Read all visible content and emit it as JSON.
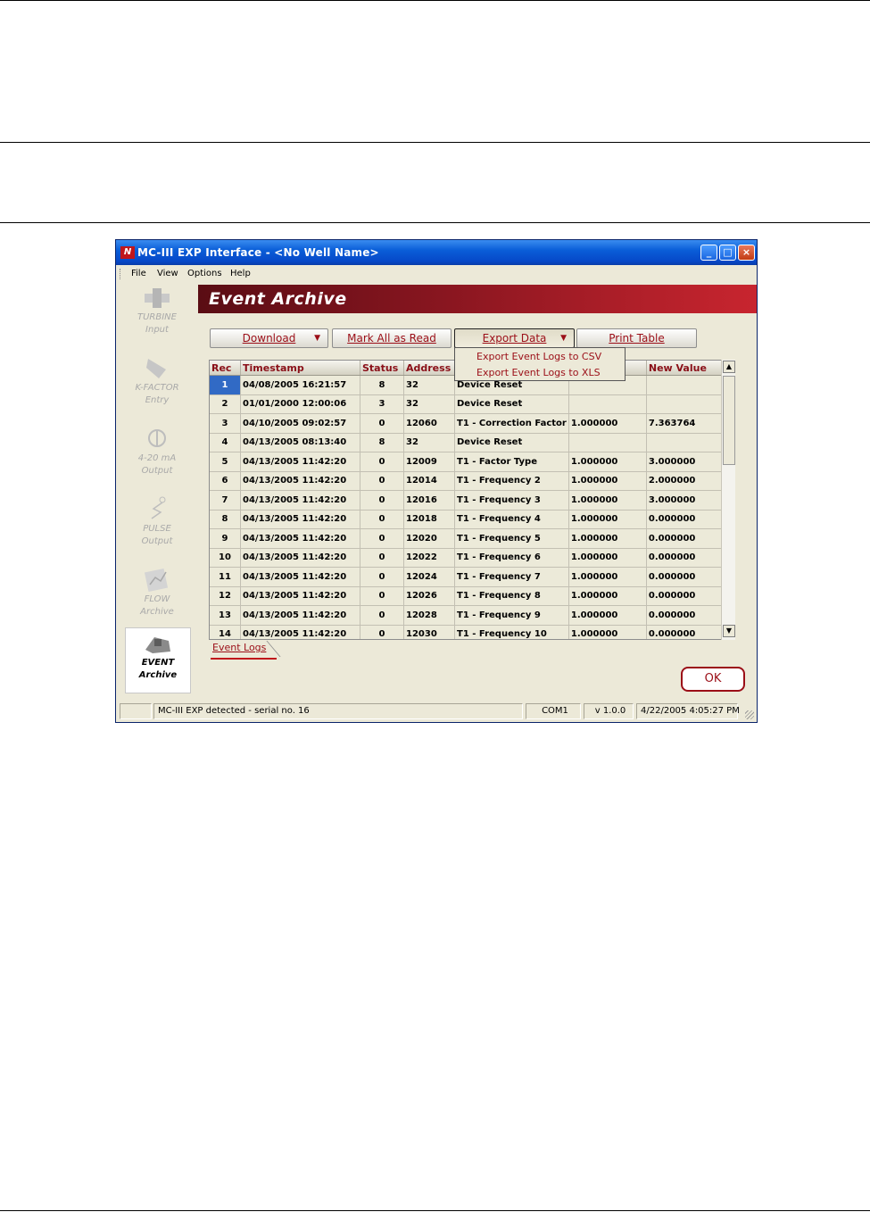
{
  "window": {
    "title": "MC-III EXP Interface - <No Well Name>",
    "logo_text": "N",
    "buttons": {
      "minimize": "_",
      "maximize": "□",
      "close": "×"
    }
  },
  "menu": [
    "File",
    "View",
    "Options",
    "Help"
  ],
  "sidebar": [
    {
      "line1": "TURBINE",
      "line2": "Input",
      "icon": "turbine-icon"
    },
    {
      "line1": "K-FACTOR",
      "line2": "Entry",
      "icon": "k-factor-icon"
    },
    {
      "line1": "4-20 mA",
      "line2": "Output",
      "icon": "analog-output-icon"
    },
    {
      "line1": "PULSE",
      "line2": "Output",
      "icon": "pulse-output-icon"
    },
    {
      "line1": "FLOW",
      "line2": "Archive",
      "icon": "flow-archive-icon"
    },
    {
      "line1": "EVENT",
      "line2": "Archive",
      "icon": "event-archive-icon",
      "active": true
    }
  ],
  "header": {
    "title": "Event Archive"
  },
  "toolbar": {
    "download": "Download",
    "mark_all": "Mark All as Read",
    "export": "Export Data",
    "print": "Print Table",
    "dropdown_arrow": "▼"
  },
  "export_menu": [
    "Export Event Logs to CSV",
    "Export Event Logs to XLS"
  ],
  "table": {
    "columns": [
      "Rec",
      "Timestamp",
      "Status",
      "Address",
      "",
      "",
      "New Value"
    ],
    "rows": [
      [
        "1",
        "04/08/2005 16:21:57",
        "8",
        "32",
        "Device Reset",
        "",
        ""
      ],
      [
        "2",
        "01/01/2000 12:00:06",
        "3",
        "32",
        "Device Reset",
        "",
        ""
      ],
      [
        "3",
        "04/10/2005 09:02:57",
        "0",
        "12060",
        "T1 - Correction Factor",
        "1.000000",
        "7.363764"
      ],
      [
        "4",
        "04/13/2005 08:13:40",
        "8",
        "32",
        "Device Reset",
        "",
        ""
      ],
      [
        "5",
        "04/13/2005 11:42:20",
        "0",
        "12009",
        "T1 - Factor Type",
        "1.000000",
        "3.000000"
      ],
      [
        "6",
        "04/13/2005 11:42:20",
        "0",
        "12014",
        "T1 - Frequency 2",
        "1.000000",
        "2.000000"
      ],
      [
        "7",
        "04/13/2005 11:42:20",
        "0",
        "12016",
        "T1 - Frequency 3",
        "1.000000",
        "3.000000"
      ],
      [
        "8",
        "04/13/2005 11:42:20",
        "0",
        "12018",
        "T1 - Frequency 4",
        "1.000000",
        "0.000000"
      ],
      [
        "9",
        "04/13/2005 11:42:20",
        "0",
        "12020",
        "T1 - Frequency 5",
        "1.000000",
        "0.000000"
      ],
      [
        "10",
        "04/13/2005 11:42:20",
        "0",
        "12022",
        "T1 - Frequency 6",
        "1.000000",
        "0.000000"
      ],
      [
        "11",
        "04/13/2005 11:42:20",
        "0",
        "12024",
        "T1 - Frequency 7",
        "1.000000",
        "0.000000"
      ],
      [
        "12",
        "04/13/2005 11:42:20",
        "0",
        "12026",
        "T1 - Frequency 8",
        "1.000000",
        "0.000000"
      ],
      [
        "13",
        "04/13/2005 11:42:20",
        "0",
        "12028",
        "T1 - Frequency 9",
        "1.000000",
        "0.000000"
      ],
      [
        "14",
        "04/13/2005 11:42:20",
        "0",
        "12030",
        "T1 - Frequency 10",
        "1.000000",
        "0.000000"
      ]
    ],
    "selected_row": 1
  },
  "scroll": {
    "up": "▲",
    "down": "▼"
  },
  "tab": "Event Logs",
  "ok_button": "OK",
  "status": {
    "message": "MC-III EXP detected - serial no. 16",
    "port": "COM1",
    "version": "v 1.0.0",
    "datetime": "4/22/2005 4:05:27 PM"
  },
  "colors": {
    "accent": "#9b0e17",
    "selection": "#316ac5",
    "title_bar": "#0a5ed8"
  }
}
